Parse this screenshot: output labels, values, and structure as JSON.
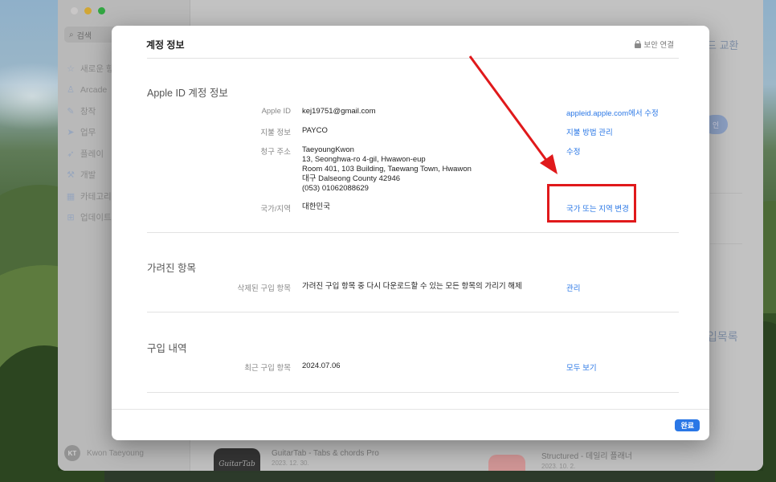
{
  "sidebar": {
    "search_placeholder": "검색",
    "items": [
      {
        "label": "새로운 항목",
        "icon": "star-icon"
      },
      {
        "label": "Arcade",
        "icon": "joystick-icon"
      },
      {
        "label": "창작",
        "icon": "brush-icon"
      },
      {
        "label": "업무",
        "icon": "paperplane-icon"
      },
      {
        "label": "플레이",
        "icon": "rocket-icon"
      },
      {
        "label": "개발",
        "icon": "hammer-icon"
      },
      {
        "label": "카테고리",
        "icon": "grid-icon"
      },
      {
        "label": "업데이트",
        "icon": "download-icon"
      }
    ],
    "user_initials": "KT",
    "user_name": "Kwon Taeyoung"
  },
  "background": {
    "right_text_1": "드 교환",
    "right_pill": "인",
    "right_text_2": "입목록",
    "app1_name": "GuitarTab - Tabs & chords Pro",
    "app1_date": "2023. 12. 30.",
    "app1_icon_text": "GuitarTab",
    "app2_name": "Structured - 데일리 플래너",
    "app2_date": "2023. 10. 2."
  },
  "sheet": {
    "title": "계정 정보",
    "secure_label": "보안 연결",
    "done_label": "완료",
    "apple_id_section": {
      "title": "Apple ID 계정 정보",
      "apple_id_label": "Apple ID",
      "apple_id_value": "kej19751@gmail.com",
      "apple_id_link": "appleid.apple.com에서 수정",
      "payment_label": "지불 정보",
      "payment_value": "PAYCO",
      "payment_link": "지불 방법 관리",
      "billing_label": "청구 주소",
      "billing_lines": [
        "TaeyoungKwon",
        "13, Seonghwa-ro 4-gil, Hwawon-eup",
        "Room 401, 103 Building, Taewang Town, Hwawon",
        "대구 Dalseong County 42946",
        "(053) 01062088629"
      ],
      "billing_link": "수정",
      "country_label": "국가/지역",
      "country_value": "대한민국",
      "country_link": "국가 또는 지역 변경"
    },
    "hidden_section": {
      "title": "가려진 항목",
      "label": "삭제된 구입 항목",
      "value": "가려진 구입 항목 중 다시 다운로드할 수 있는 모든 항목의 가리기 해제",
      "link": "관리"
    },
    "history_section": {
      "title": "구입 내역",
      "label": "최근 구입 항목",
      "value": "2024.07.06",
      "link": "모두 보기"
    }
  },
  "annotation": {
    "color": "#e0191b"
  }
}
